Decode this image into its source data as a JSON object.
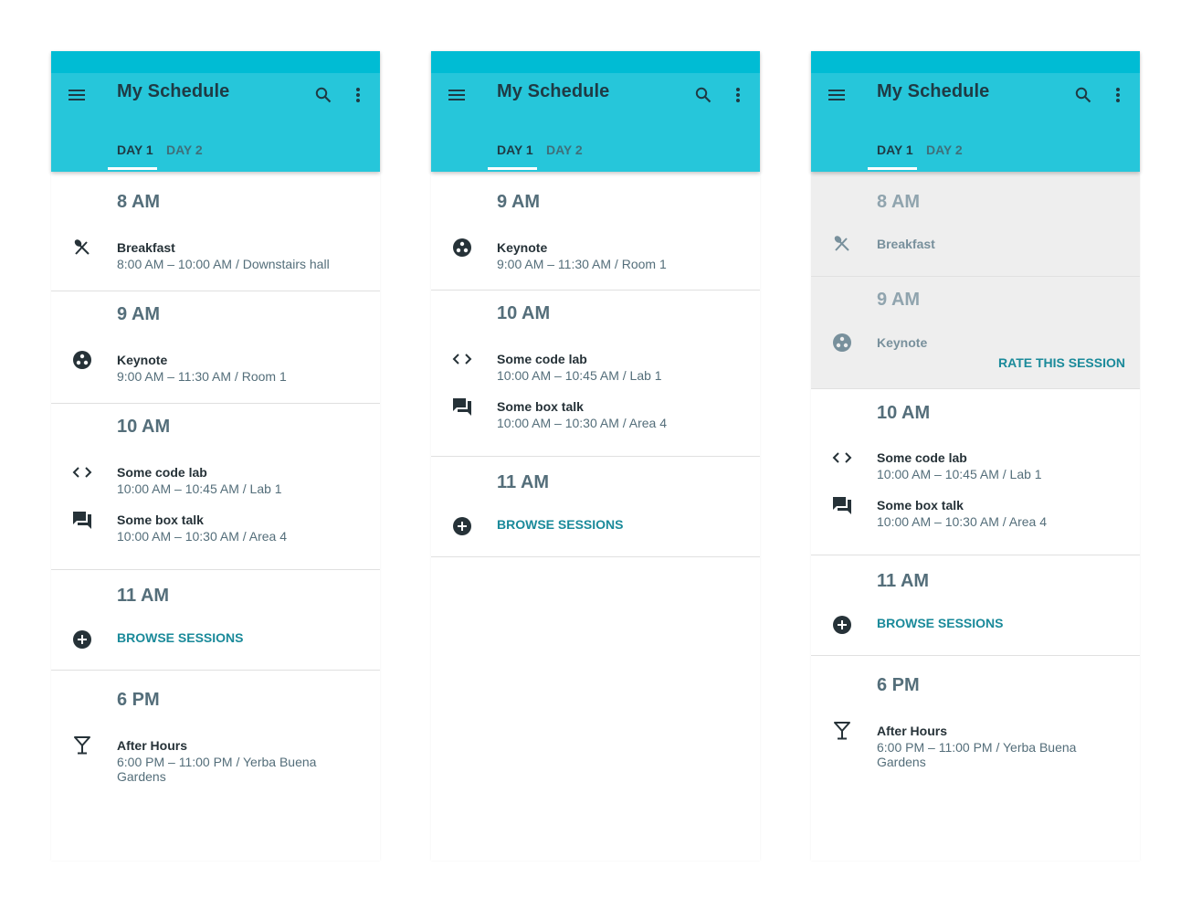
{
  "app": {
    "title": "My Schedule",
    "tabs": [
      "DAY 1",
      "DAY 2"
    ],
    "accent_color": "#26c6da",
    "statusbar_color": "#00bcd4",
    "link_color": "#1a8a9a"
  },
  "screen1": {
    "blocks": [
      {
        "time": "8 AM",
        "items": [
          {
            "title": "Breakfast",
            "sub": "8:00 AM – 10:00 AM  /  Downstairs hall",
            "icon": "restaurant-icon"
          }
        ]
      },
      {
        "time": "9 AM",
        "items": [
          {
            "title": "Keynote",
            "sub": "9:00 AM – 11:30 AM  /  Room 1",
            "icon": "keynote-icon"
          }
        ]
      },
      {
        "time": "10 AM",
        "items": [
          {
            "title": "Some code lab",
            "sub": "10:00 AM – 10:45 AM  /  Lab 1",
            "icon": "code-icon"
          },
          {
            "title": "Some box talk",
            "sub": "10:00 AM – 10:30 AM  /  Area 4",
            "icon": "forum-icon"
          }
        ]
      },
      {
        "time": "11 AM",
        "browse": "BROWSE SESSIONS"
      },
      {
        "time": "6 PM",
        "items": [
          {
            "title": "After Hours",
            "sub": "6:00 PM – 11:00 PM / Yerba Buena Gardens",
            "icon": "cocktail-icon"
          }
        ]
      }
    ]
  },
  "screen2": {
    "blocks": [
      {
        "time": "9 AM",
        "items": [
          {
            "title": "Keynote",
            "sub": "9:00 AM – 11:30 AM  /  Room 1",
            "icon": "keynote-icon"
          }
        ]
      },
      {
        "time": "10 AM",
        "items": [
          {
            "title": "Some code lab",
            "sub": "10:00 AM – 10:45 AM  /  Lab 1",
            "icon": "code-icon"
          },
          {
            "title": "Some box talk",
            "sub": "10:00 AM – 10:30 AM  /  Area 4",
            "icon": "forum-icon"
          }
        ]
      },
      {
        "time": "11 AM",
        "browse": "BROWSE SESSIONS"
      }
    ]
  },
  "screen3": {
    "blocks": [
      {
        "time": "8 AM",
        "past": true,
        "items": [
          {
            "title": "Breakfast",
            "icon": "restaurant-icon"
          }
        ]
      },
      {
        "time": "9 AM",
        "past": true,
        "items": [
          {
            "title": "Keynote",
            "icon": "keynote-icon"
          }
        ],
        "rate": "RATE THIS SESSION"
      },
      {
        "time": "10 AM",
        "items": [
          {
            "title": "Some code lab",
            "sub": "10:00 AM – 10:45 AM  /  Lab 1",
            "icon": "code-icon"
          },
          {
            "title": "Some box talk",
            "sub": "10:00 AM – 10:30 AM  /  Area 4",
            "icon": "forum-icon"
          }
        ]
      },
      {
        "time": "11 AM",
        "browse": "BROWSE SESSIONS"
      },
      {
        "time": "6 PM",
        "items": [
          {
            "title": "After Hours",
            "sub": "6:00 PM – 11:00 PM / Yerba Buena Gardens",
            "icon": "cocktail-icon"
          }
        ]
      }
    ]
  }
}
